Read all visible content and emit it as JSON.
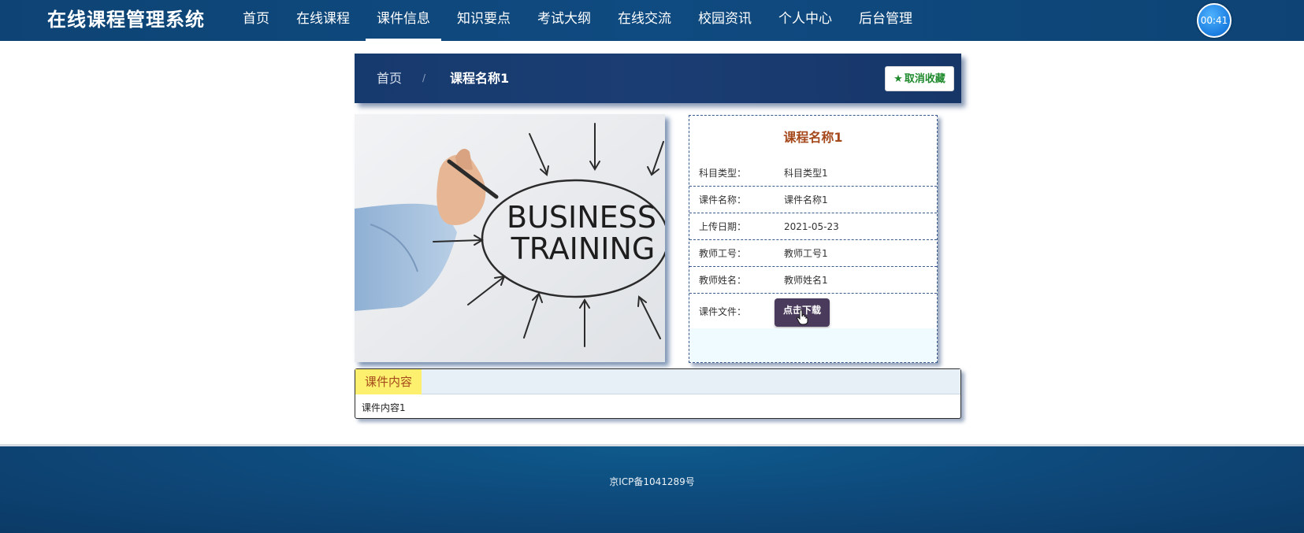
{
  "app": {
    "title": "在线课程管理系统"
  },
  "nav": {
    "items": [
      {
        "label": "首页"
      },
      {
        "label": "在线课程"
      },
      {
        "label": "课件信息"
      },
      {
        "label": "知识要点"
      },
      {
        "label": "考试大纲"
      },
      {
        "label": "在线交流"
      },
      {
        "label": "校园资讯"
      },
      {
        "label": "个人中心"
      },
      {
        "label": "后台管理"
      }
    ],
    "active_index": 2,
    "timer": "00:41"
  },
  "breadcrumb": {
    "home": "首页",
    "separator": "/",
    "current": "课程名称1",
    "fav_label": "取消收藏"
  },
  "image": {
    "text_line1": "BUSINESS",
    "text_line2": "TRAINING"
  },
  "detail": {
    "title": "课程名称1",
    "rows": [
      {
        "label": "科目类型：",
        "value": "科目类型1"
      },
      {
        "label": "课件名称：",
        "value": "课件名称1"
      },
      {
        "label": "上传日期：",
        "value": "2021-05-23"
      },
      {
        "label": "教师工号：",
        "value": "教师工号1"
      },
      {
        "label": "教师姓名：",
        "value": "教师姓名1"
      }
    ],
    "file_label": "课件文件：",
    "download_label": "点击下载"
  },
  "content": {
    "tab_label": "课件内容",
    "body": "课件内容1"
  },
  "footer": {
    "icp": "京ICP备1041289号"
  },
  "colors": {
    "nav_bg": "#0f4a80",
    "breadcrumb_bg": "#1a3d73",
    "title_accent": "#a5481b",
    "fav_green": "#1e8a2c",
    "download_bg": "#4a3a5c",
    "tab_yellow": "#fcf06e"
  }
}
